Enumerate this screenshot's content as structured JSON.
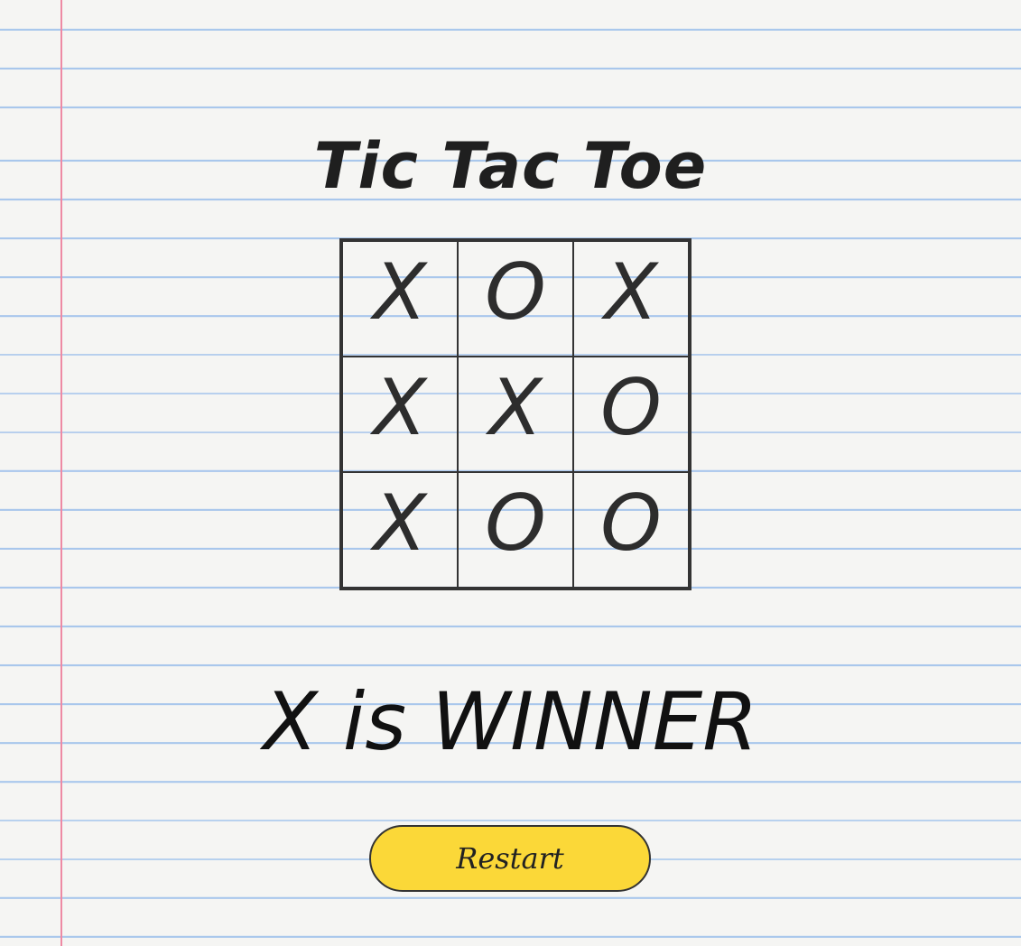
{
  "title": "Tic Tac Toe",
  "board": {
    "cells": [
      "X",
      "O",
      "X",
      "X",
      "X",
      "O",
      "X",
      "O",
      "O"
    ]
  },
  "status": "X is WINNER",
  "restart_label": "Restart",
  "colors": {
    "paper": "#f5f5f3",
    "rule_line": "#a9c7ec",
    "margin_line": "#ee8aa4",
    "ink": "#1f1f1f",
    "button": "#fbd838"
  }
}
